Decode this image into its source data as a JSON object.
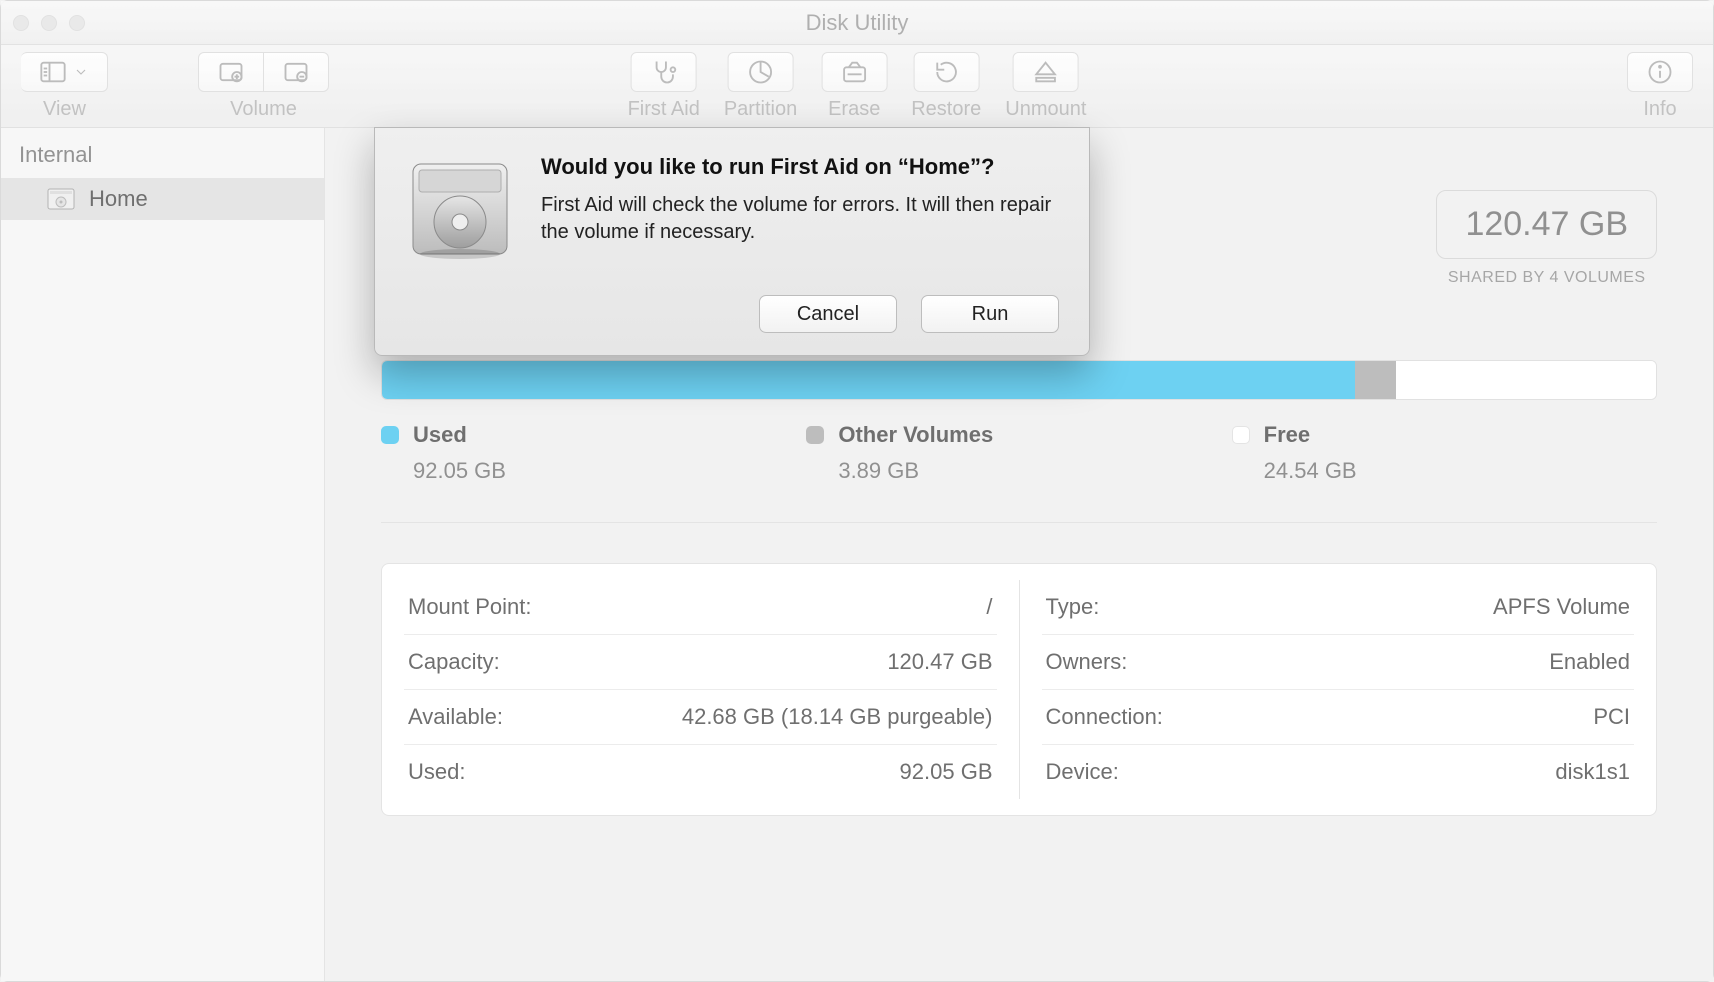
{
  "window": {
    "title": "Disk Utility"
  },
  "toolbar": {
    "view": "View",
    "volume": "Volume",
    "first_aid": "First Aid",
    "partition": "Partition",
    "erase": "Erase",
    "restore": "Restore",
    "unmount": "Unmount",
    "info": "Info"
  },
  "sidebar": {
    "section": "Internal",
    "items": [
      {
        "label": "Home"
      }
    ]
  },
  "capacity": {
    "total": "120.47 GB",
    "subtitle": "SHARED BY 4 VOLUMES"
  },
  "usage": {
    "used": {
      "label": "Used",
      "value": "92.05 GB",
      "color": "#1fb9ec",
      "pct": 76.4
    },
    "other": {
      "label": "Other Volumes",
      "value": "3.89 GB",
      "color": "#9a9a9a",
      "pct": 3.2
    },
    "free": {
      "label": "Free",
      "value": "24.54 GB",
      "color": "#ffffff",
      "pct": 20.4
    }
  },
  "info": {
    "left": [
      {
        "k": "Mount Point:",
        "v": "/"
      },
      {
        "k": "Capacity:",
        "v": "120.47 GB"
      },
      {
        "k": "Available:",
        "v": "42.68 GB (18.14 GB purgeable)"
      },
      {
        "k": "Used:",
        "v": "92.05 GB"
      }
    ],
    "right": [
      {
        "k": "Type:",
        "v": "APFS Volume"
      },
      {
        "k": "Owners:",
        "v": "Enabled"
      },
      {
        "k": "Connection:",
        "v": "PCI"
      },
      {
        "k": "Device:",
        "v": "disk1s1"
      }
    ]
  },
  "dialog": {
    "title": "Would you like to run First Aid on “Home”?",
    "body": "First Aid will check the volume for errors. It will then repair the volume if necessary.",
    "cancel": "Cancel",
    "run": "Run"
  }
}
